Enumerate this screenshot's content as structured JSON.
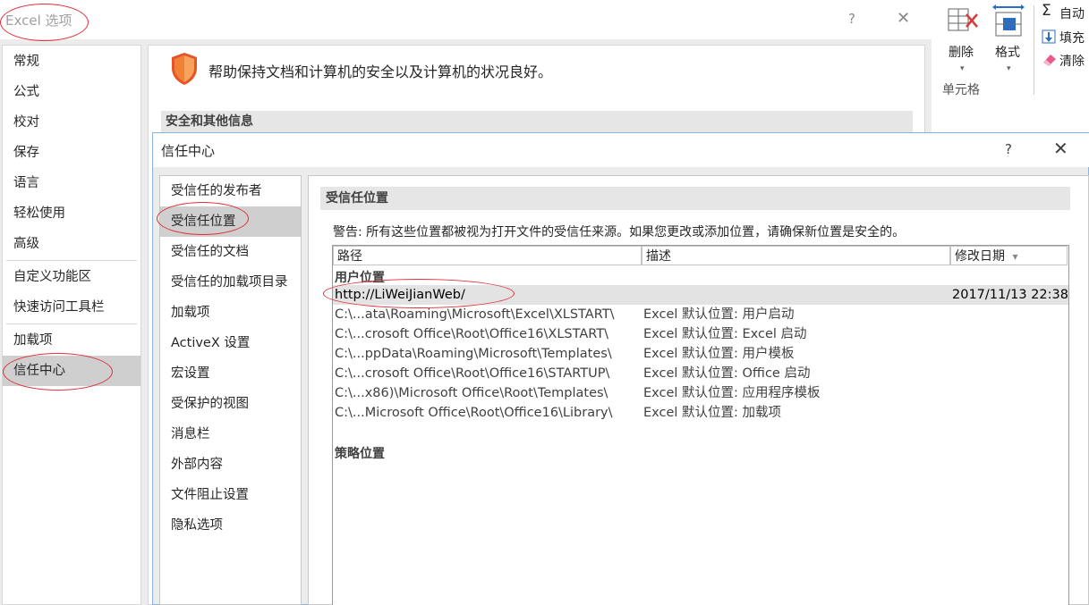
{
  "ribbon": {
    "delete_label": "删除",
    "format_label": "格式",
    "group_label": "单元格",
    "autosum_label": "自动",
    "fill_label": "填充",
    "clear_label": "清除"
  },
  "options_window": {
    "title": "Excel 选项",
    "help": "?",
    "close": "✕",
    "nav": {
      "items": [
        "常规",
        "公式",
        "校对",
        "保存",
        "语言",
        "轻松使用",
        "高级",
        "自定义功能区",
        "快速访问工具栏",
        "加载项",
        "信任中心"
      ],
      "selected": "信任中心"
    },
    "tagline": "帮助保持文档和计算机的安全以及计算机的状况良好。",
    "section_title": "安全和其他信息"
  },
  "trust_center": {
    "title": "信任中心",
    "help": "?",
    "close": "✕",
    "nav": {
      "items": [
        "受信任的发布者",
        "受信任位置",
        "受信任的文档",
        "受信任的加载项目录",
        "加载项",
        "ActiveX 设置",
        "宏设置",
        "受保护的视图",
        "消息栏",
        "外部内容",
        "文件阻止设置",
        "隐私选项"
      ],
      "selected": "受信任位置"
    },
    "section_title": "受信任位置",
    "warning": "警告: 所有这些位置都被视为打开文件的受信任来源。如果您更改或添加位置，请确保新位置是安全的。",
    "table": {
      "columns": [
        "路径",
        "描述",
        "修改日期"
      ],
      "sort_indicator": "▾",
      "user_group_label": "用户位置",
      "user_rows": [
        {
          "path": "http://LiWeiJianWeb/",
          "description": "",
          "date": "2017/11/13 22:38"
        },
        {
          "path": "C:\\...ata\\Roaming\\Microsoft\\Excel\\XLSTART\\",
          "description": "Excel 默认位置: 用户启动",
          "date": ""
        },
        {
          "path": "C:\\...crosoft Office\\Root\\Office16\\XLSTART\\",
          "description": "Excel 默认位置: Excel 启动",
          "date": ""
        },
        {
          "path": "C:\\...ppData\\Roaming\\Microsoft\\Templates\\",
          "description": "Excel 默认位置: 用户模板",
          "date": ""
        },
        {
          "path": "C:\\...crosoft Office\\Root\\Office16\\STARTUP\\",
          "description": "Excel 默认位置: Office 启动",
          "date": ""
        },
        {
          "path": "C:\\...x86)\\Microsoft Office\\Root\\Templates\\",
          "description": "Excel 默认位置: 应用程序模板",
          "date": ""
        },
        {
          "path": "C:\\...Microsoft Office\\Root\\Office16\\Library\\",
          "description": "Excel 默认位置: 加载项",
          "date": ""
        }
      ],
      "policy_group_label": "策略位置"
    }
  },
  "colors": {
    "annotation": "#e0303a",
    "selection": "#cfcfcf",
    "shield": "#e8542a",
    "dialog_border": "#8ab4e0"
  }
}
